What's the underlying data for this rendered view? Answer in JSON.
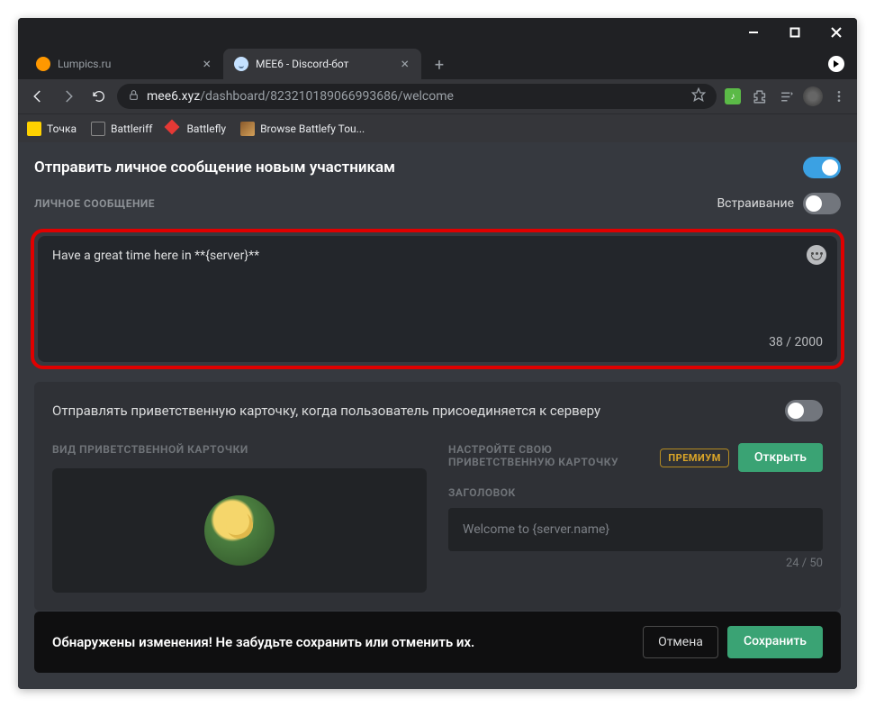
{
  "window": {
    "tabs": [
      {
        "title": "Lumpics.ru",
        "active": false
      },
      {
        "title": "MEE6 - Discord-бот",
        "active": true
      }
    ]
  },
  "addressbar": {
    "host": "mee6.xyz",
    "path": "/dashboard/823210189066993686/welcome"
  },
  "bookmarks": [
    {
      "label": "Точка"
    },
    {
      "label": "Battleriff"
    },
    {
      "label": "Battlefly"
    },
    {
      "label": "Browse Battlefy Tou..."
    }
  ],
  "sections": {
    "pm": {
      "title": "Отправить личное сообщение новым участникам",
      "subhead": "ЛИЧНОЕ СООБЩЕНИЕ",
      "embed_label": "Встраивание",
      "message_text": "Have a great time here in **{server}**",
      "counter": "38 / 2000"
    },
    "card": {
      "title": "Отправлять приветственную карточку, когда пользователь присоединяется к серверу",
      "left_head": "ВИД ПРИВЕТСТВЕННОЙ КАРТОЧКИ",
      "right_head": "НАСТРОЙТЕ СВОЮ ПРИВЕТСТВЕННУЮ КАРТОЧКУ",
      "premium": "ПРЕМИУМ",
      "open": "Открыть",
      "title_label": "ЗАГОЛОВОК",
      "title_value": "Welcome to {server.name}",
      "title_counter": "24 / 50"
    }
  },
  "savebar": {
    "text": "Обнаружены изменения! Не забудьте сохранить или отменить их.",
    "cancel": "Отмена",
    "save": "Сохранить"
  }
}
